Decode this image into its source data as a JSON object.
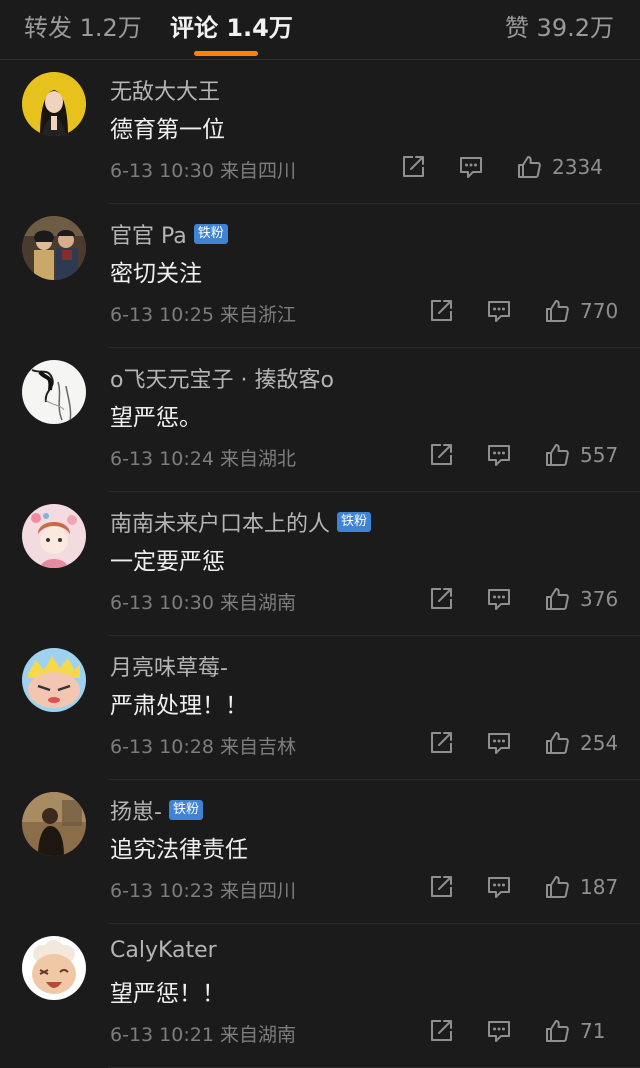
{
  "tabs": {
    "repost": "转发 1.2万",
    "comment": "评论 1.4万",
    "like": "赞 39.2万"
  },
  "colors": {
    "accent": "#ff8200",
    "badge": "#3f83d6",
    "background": "#1b1b1b"
  },
  "comments": [
    {
      "user": "无敌大大王",
      "badge": "",
      "text": "德育第一位",
      "time": "6-13 10:30",
      "source": "来自四川",
      "likes": "2334",
      "avatar": "woman-yellow-bg"
    },
    {
      "user": "官官 Pa",
      "badge": "铁粉",
      "text": "密切关注",
      "time": "6-13 10:25",
      "source": "来自浙江",
      "likes": "770",
      "avatar": "two-people-photo"
    },
    {
      "user": "o飞天元宝子 · 揍敌客o",
      "badge": "",
      "text": "望严惩。",
      "time": "6-13 10:24",
      "source": "来自湖北",
      "likes": "557",
      "avatar": "sketch-illustration"
    },
    {
      "user": "南南未来户口本上的人",
      "badge": "铁粉",
      "text": "一定要严惩",
      "time": "6-13 10:30",
      "source": "来自湖南",
      "likes": "376",
      "avatar": "pink-illustration"
    },
    {
      "user": "月亮味草莓-",
      "badge": "",
      "text": "严肃处理！！",
      "time": "6-13 10:28",
      "source": "来自吉林",
      "likes": "254",
      "avatar": "cartoon-face"
    },
    {
      "user": "扬崽-",
      "badge": "铁粉",
      "text": "追究法律责任",
      "time": "6-13 10:23",
      "source": "来自四川",
      "likes": "187",
      "avatar": "dark-photo"
    },
    {
      "user": "CalyKater",
      "badge": "",
      "text": "望严惩！！",
      "time": "6-13 10:21",
      "source": "来自湖南",
      "likes": "71",
      "avatar": "cartoon-sheep"
    }
  ],
  "icons": {
    "share": "share-icon",
    "reply": "comment-icon",
    "like": "thumbs-up-icon"
  }
}
